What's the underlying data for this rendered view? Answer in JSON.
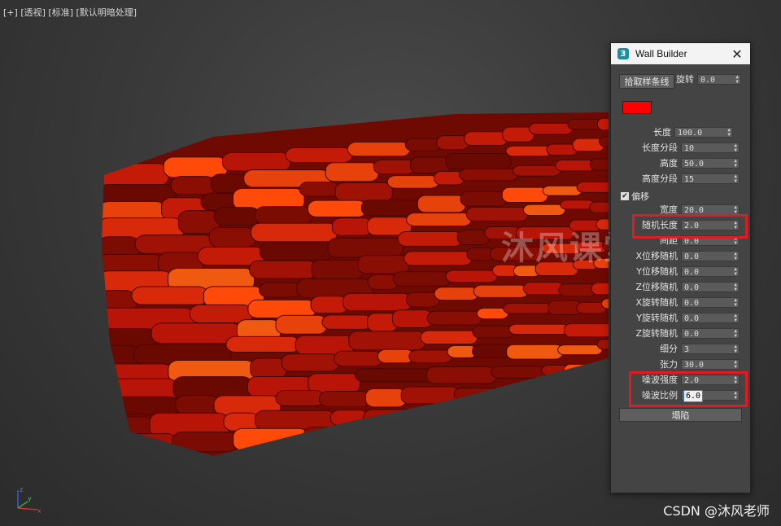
{
  "viewport": {
    "label_plus": "[+]",
    "label_view": "[透视]",
    "label_shading": "[标准]",
    "label_lighting": "[默认明暗处理]"
  },
  "watermark": "沐风课堂",
  "credit": "CSDN @沐风老师",
  "axis": {
    "x": "x",
    "y": "y",
    "z": "z"
  },
  "dialog": {
    "icon": "3",
    "title": "Wall Builder",
    "close_icon": "✕",
    "pick_spline_label": "拾取样条线",
    "rotation_label": "旋转",
    "rotation_value": "0.0",
    "color": "#ff0000",
    "offset_label": "偏移",
    "offset_checked": "✔",
    "collapse_label": "塌陷",
    "params": [
      {
        "label": "长度",
        "value": "100.0"
      },
      {
        "label": "长度分段",
        "value": "10"
      },
      {
        "label": "高度",
        "value": "50.0"
      },
      {
        "label": "高度分段",
        "value": "15"
      },
      {
        "label": "宽度",
        "value": "20.0"
      },
      {
        "label": "随机长度",
        "value": "2.0"
      },
      {
        "label": "间距",
        "value": "0.0"
      },
      {
        "label": "X位移随机",
        "value": "0.0"
      },
      {
        "label": "Y位移随机",
        "value": "0.0"
      },
      {
        "label": "Z位移随机",
        "value": "0.0"
      },
      {
        "label": "X旋转随机",
        "value": "0.0"
      },
      {
        "label": "Y旋转随机",
        "value": "0.0"
      },
      {
        "label": "Z旋转随机",
        "value": "0.0"
      },
      {
        "label": "细分",
        "value": "3"
      },
      {
        "label": "张力",
        "value": "30.0"
      },
      {
        "label": "噪波强度",
        "value": "2.0"
      },
      {
        "label": "噪波比例",
        "value": "6.0"
      }
    ]
  },
  "colors": {
    "highlight": "#e01b24",
    "panel": "#444444",
    "brick_base": "#b01000"
  }
}
